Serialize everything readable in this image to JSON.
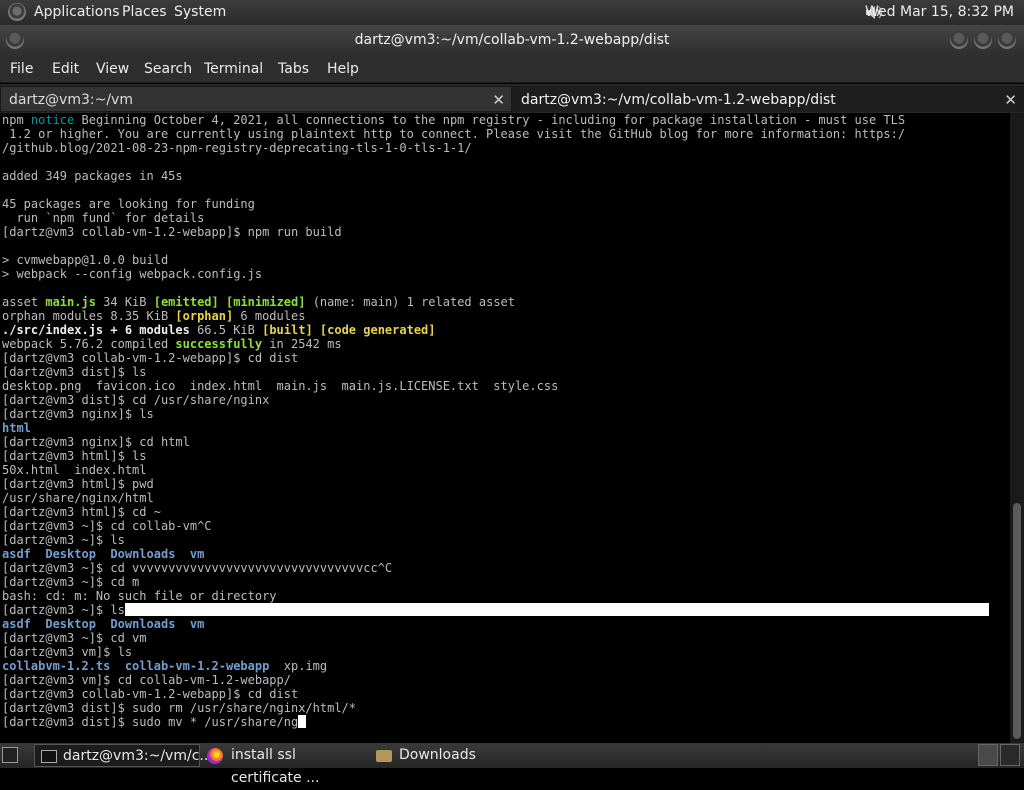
{
  "top_panel": {
    "menus": [
      "Applications",
      "Places",
      "System"
    ],
    "clock": "Wed Mar 15,  8:32 PM"
  },
  "window": {
    "title": "dartz@vm3:~/vm/collab-vm-1.2-webapp/dist"
  },
  "menu_bar": [
    "File",
    "Edit",
    "View",
    "Search",
    "Terminal",
    "Tabs",
    "Help"
  ],
  "tabs": [
    {
      "label": "dartz@vm3:~/vm",
      "active": false
    },
    {
      "label": "dartz@vm3:~/vm/collab-vm-1.2-webapp/dist",
      "active": true
    }
  ],
  "terminal": {
    "lines": [
      [
        {
          "t": "npm "
        },
        {
          "t": "notice",
          "c": "cyan"
        },
        {
          "t": " Beginning October 4, 2021, all connections to the npm registry - including for package installation - must use TLS"
        }
      ],
      [
        {
          "t": " 1.2 or higher. You are currently using plaintext http to connect. Please visit the GitHub blog for more information: https:/"
        }
      ],
      [
        {
          "t": "/github.blog/2021-08-23-npm-registry-deprecating-tls-1-0-tls-1-1/"
        }
      ],
      [
        {
          "t": ""
        }
      ],
      [
        {
          "t": "added 349 packages in 45s"
        }
      ],
      [
        {
          "t": ""
        }
      ],
      [
        {
          "t": "45 packages are looking for funding"
        }
      ],
      [
        {
          "t": "  run `npm fund` for details"
        }
      ],
      [
        {
          "t": "[dartz@vm3 collab-vm-1.2-webapp]$ npm run build"
        }
      ],
      [
        {
          "t": ""
        }
      ],
      [
        {
          "t": "> cvmwebapp@1.0.0 build"
        }
      ],
      [
        {
          "t": "> webpack --config webpack.config.js"
        }
      ],
      [
        {
          "t": ""
        }
      ],
      [
        {
          "t": "asset "
        },
        {
          "t": "main.js",
          "c": "green"
        },
        {
          "t": " 34 KiB "
        },
        {
          "t": "[emitted]",
          "c": "green"
        },
        {
          "t": " "
        },
        {
          "t": "[minimized]",
          "c": "green"
        },
        {
          "t": " (name: main) 1 related asset"
        }
      ],
      [
        {
          "t": "orphan modules 8.35 KiB "
        },
        {
          "t": "[orphan]",
          "c": "yellow"
        },
        {
          "t": " 6 modules"
        }
      ],
      [
        {
          "t": "./src/index.js + 6 modules",
          "c": "bold"
        },
        {
          "t": " 66.5 KiB "
        },
        {
          "t": "[built]",
          "c": "yellow"
        },
        {
          "t": " "
        },
        {
          "t": "[code generated]",
          "c": "yellow"
        }
      ],
      [
        {
          "t": "webpack 5.76.2 compiled "
        },
        {
          "t": "successfully",
          "c": "green"
        },
        {
          "t": " in 2542 ms"
        }
      ],
      [
        {
          "t": "[dartz@vm3 collab-vm-1.2-webapp]$ cd dist"
        }
      ],
      [
        {
          "t": "[dartz@vm3 dist]$ ls"
        }
      ],
      [
        {
          "t": "desktop.png  favicon.ico  index.html  main.js  main.js.LICENSE.txt  style.css"
        }
      ],
      [
        {
          "t": "[dartz@vm3 dist]$ cd /usr/share/nginx"
        }
      ],
      [
        {
          "t": "[dartz@vm3 nginx]$ ls"
        }
      ],
      [
        {
          "t": "html",
          "c": "blue"
        }
      ],
      [
        {
          "t": "[dartz@vm3 nginx]$ cd html"
        }
      ],
      [
        {
          "t": "[dartz@vm3 html]$ ls"
        }
      ],
      [
        {
          "t": "50x.html  index.html"
        }
      ],
      [
        {
          "t": "[dartz@vm3 html]$ pwd"
        }
      ],
      [
        {
          "t": "/usr/share/nginx/html"
        }
      ],
      [
        {
          "t": "[dartz@vm3 html]$ cd ~"
        }
      ],
      [
        {
          "t": "[dartz@vm3 ~]$ cd collab-vm^C"
        }
      ],
      [
        {
          "t": "[dartz@vm3 ~]$ ls"
        }
      ],
      [
        {
          "t": "asdf",
          "c": "blue"
        },
        {
          "t": "  "
        },
        {
          "t": "Desktop",
          "c": "blue"
        },
        {
          "t": "  "
        },
        {
          "t": "Downloads",
          "c": "blue"
        },
        {
          "t": "  "
        },
        {
          "t": "vm",
          "c": "blue"
        }
      ],
      [
        {
          "t": "[dartz@vm3 ~]$ cd vvvvvvvvvvvvvvvvvvvvvvvvvvvvvvvvcc^C"
        }
      ],
      [
        {
          "t": "[dartz@vm3 ~]$ cd m"
        }
      ],
      [
        {
          "t": "bash: cd: m: No such file or directory"
        }
      ],
      [
        {
          "t": "[dartz@vm3 ~]$ ls"
        },
        {
          "t": "",
          "c": "highlight"
        }
      ],
      [
        {
          "t": "asdf",
          "c": "blue"
        },
        {
          "t": "  "
        },
        {
          "t": "Desktop",
          "c": "blue"
        },
        {
          "t": "  "
        },
        {
          "t": "Downloads",
          "c": "blue"
        },
        {
          "t": "  "
        },
        {
          "t": "vm",
          "c": "blue"
        }
      ],
      [
        {
          "t": "[dartz@vm3 ~]$ cd vm"
        }
      ],
      [
        {
          "t": "[dartz@vm3 vm]$ ls"
        }
      ],
      [
        {
          "t": "collabvm-1.2.ts",
          "c": "blue"
        },
        {
          "t": "  "
        },
        {
          "t": "collab-vm-1.2-webapp",
          "c": "blue"
        },
        {
          "t": "  xp.img"
        }
      ],
      [
        {
          "t": "[dartz@vm3 vm]$ cd collab-vm-1.2-webapp/"
        }
      ],
      [
        {
          "t": "[dartz@vm3 collab-vm-1.2-webapp]$ cd dist"
        }
      ],
      [
        {
          "t": "[dartz@vm3 dist]$ sudo rm /usr/share/nginx/html/*"
        }
      ],
      [
        {
          "t": "[dartz@vm3 dist]$ sudo mv * /usr/share/ng"
        },
        {
          "t": "",
          "c": "cursor"
        }
      ]
    ]
  },
  "taskbar": {
    "items": [
      {
        "label": "dartz@vm3:~/vm/c...",
        "icon": "terminal-icon",
        "active": true
      },
      {
        "label": "install ssl certificate ...",
        "icon": "firefox-icon",
        "active": false
      },
      {
        "label": "Downloads",
        "icon": "folder-icon",
        "active": false
      }
    ]
  }
}
